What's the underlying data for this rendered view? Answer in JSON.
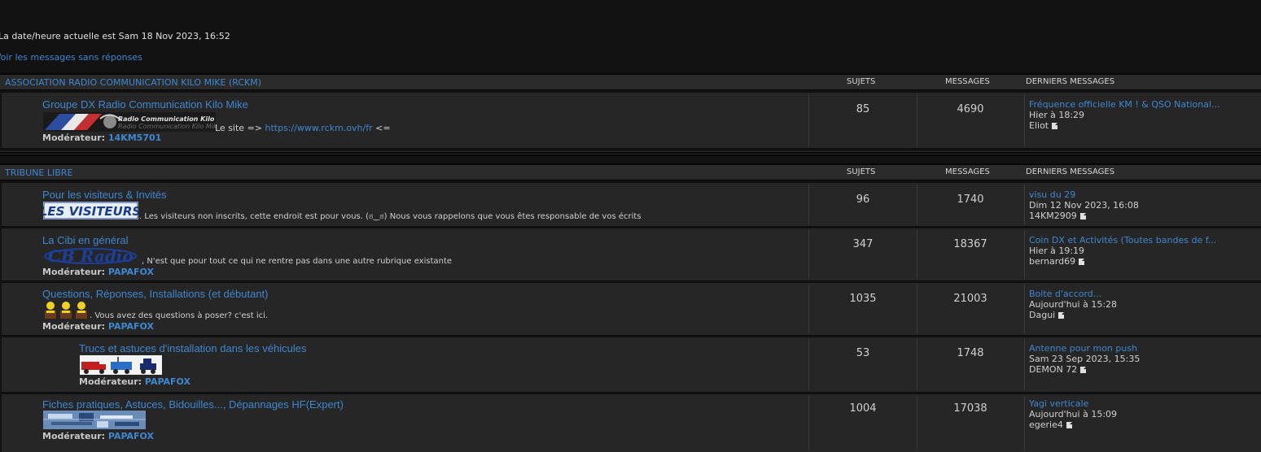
{
  "header": {
    "current_time": "La date/heure actuelle est Sam 18 Nov 2023, 16:52",
    "unanswered_link": "Voir les messages sans réponses"
  },
  "columns": {
    "topics": "SUJETS",
    "posts": "MESSAGES",
    "last": "DERNIERS MESSAGES"
  },
  "categories": [
    {
      "title": "ASSOCIATION RADIO COMMUNICATION KILO MIKE (RCKM)",
      "forums": [
        {
          "title": "Groupe DX Radio Communication Kilo Mike",
          "banner_text": "Radio Communication Kilo Mike",
          "desc_prefix": "Le site => ",
          "desc_link": "https://www.rckm.ovh/fr",
          "desc_suffix": " <=",
          "moderator_label": "Modérateur:",
          "moderator": "14KM5701",
          "topics": "85",
          "posts": "4690",
          "last_title": "Fréquence officielle KM ! & QSO National...",
          "last_date": "Hier à 18:29",
          "last_user": "Eliot"
        }
      ]
    },
    {
      "title": "TRIBUNE LIBRE",
      "forums": [
        {
          "title": "Pour les visiteurs & Invités",
          "banner_text": "LES VISITEURS",
          "desc": ". Les visiteurs non inscrits, cette endroit est pour vous. (ಠ‿ಠ) Nous vous rappelons que vous êtes responsable de vos écrits",
          "topics": "96",
          "posts": "1740",
          "last_title": "visu du 29",
          "last_date": "Dim 12 Nov 2023, 16:08",
          "last_user": "14KM2909"
        },
        {
          "title": "La Cibi en général",
          "banner_text": "CB Radio",
          "desc": ", N'est que pour tout ce qui ne rentre pas dans une autre rubrique existante",
          "moderator_label": "Modérateur:",
          "moderator": "PAPAFOX",
          "topics": "347",
          "posts": "18367",
          "last_title": "Coin DX et Activités (Toutes bandes de f...",
          "last_date": "Hier à 19:19",
          "last_user": "bernard69"
        },
        {
          "title": "Questions, Réponses, Installations (et débutant)",
          "desc": ". Vous avez des questions à poser? c'est ici.",
          "moderator_label": "Modérateur:",
          "moderator": "PAPAFOX",
          "topics": "1035",
          "posts": "21003",
          "last_title": "Boite d'accord...",
          "last_date": "Aujourd'hui à 15:28",
          "last_user": "Dagui"
        },
        {
          "title": "Trucs et astuces d'installation dans les véhicules",
          "moderator_label": "Modérateur:",
          "moderator": "PAPAFOX",
          "topics": "53",
          "posts": "1748",
          "last_title": "Antenne pour mon push",
          "last_date": "Sam 23 Sep 2023, 15:35",
          "last_user": "DEMON 72"
        },
        {
          "title": "Fiches pratiques, Astuces, Bidouilles..., Dépannages HF(Expert)",
          "moderator_label": "Modérateur:",
          "moderator": "PAPAFOX",
          "topics": "1004",
          "posts": "17038",
          "last_title": "Yagi verticale",
          "last_date": "Aujourd'hui à 15:09",
          "last_user": "egerie4"
        }
      ]
    }
  ]
}
